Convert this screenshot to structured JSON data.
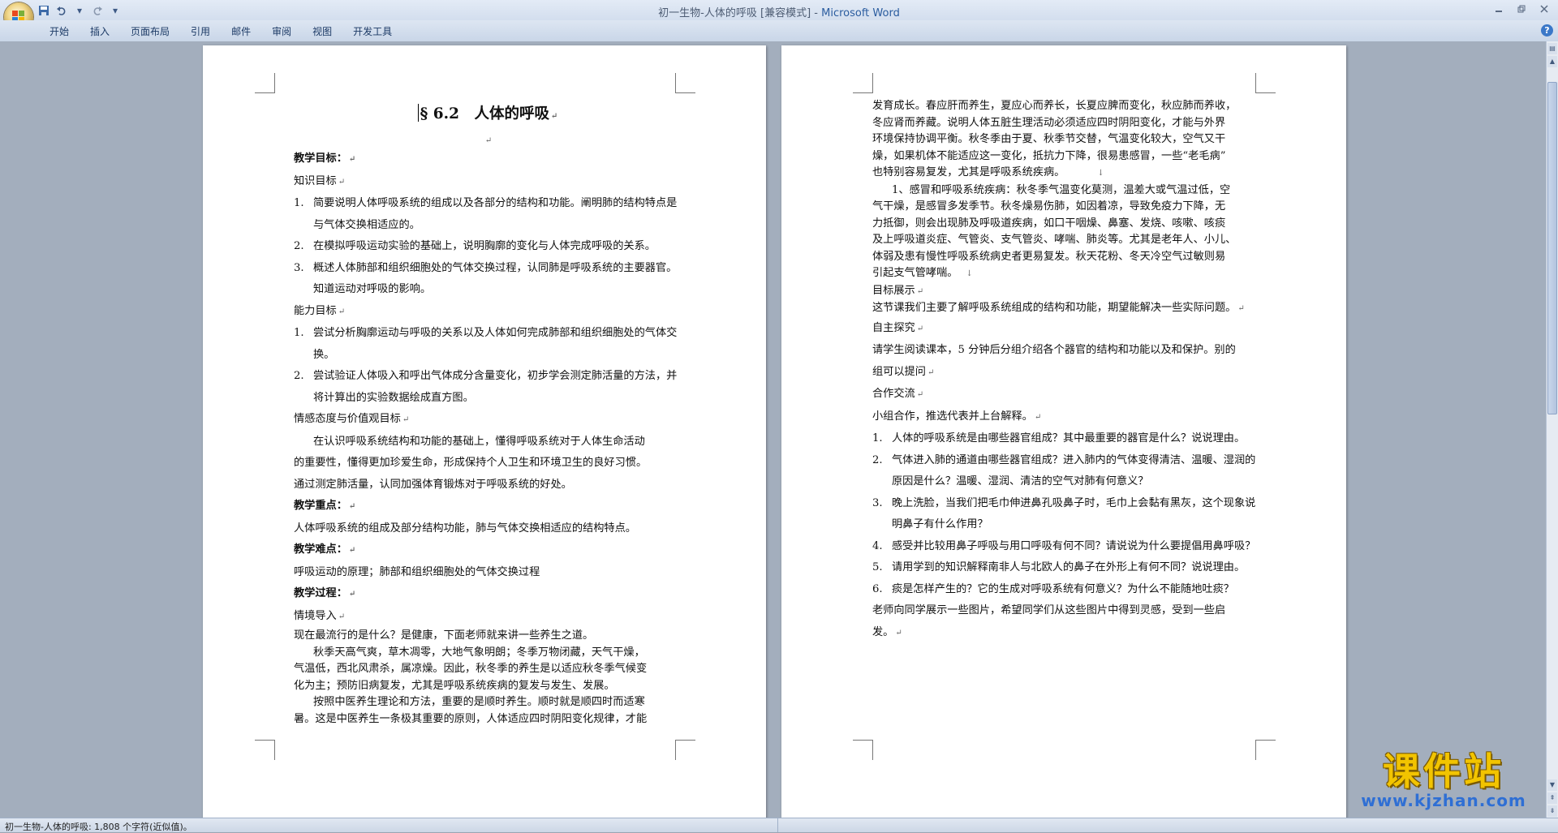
{
  "window": {
    "title_doc": "初一生物-人体的呼吸 [兼容模式] - ",
    "title_app": "Microsoft Word"
  },
  "ribbon": {
    "tabs": [
      "开始",
      "插入",
      "页面布局",
      "引用",
      "邮件",
      "审阅",
      "视图",
      "开发工具"
    ]
  },
  "quick_access": {
    "dropdown": "▾"
  },
  "colors": {
    "accent": "#2a5c9f",
    "watermark_yellow": "#f2c400",
    "watermark_blue": "#2f6fd4"
  },
  "page1": {
    "heading": "§ 6.2　人体的呼吸",
    "p_goals": "教学目标：",
    "p_knowledge": "知识目标",
    "k_items": [
      {
        "num": "1.",
        "text": "简要说明人体呼吸系统的组成以及各部分的结构和功能。阐明肺的结构特点是与气体交换相适应的。"
      },
      {
        "num": "2.",
        "text": "在模拟呼吸运动实验的基础上，说明胸廓的变化与人体完成呼吸的关系。"
      },
      {
        "num": "3.",
        "text": "概述人体肺部和组织细胞处的气体交换过程，认同肺是呼吸系统的主要器官。知道运动对呼吸的影响。"
      }
    ],
    "p_ability": "能力目标",
    "a_items": [
      {
        "num": "1.",
        "text": "尝试分析胸廓运动与呼吸的关系以及人体如何完成肺部和组织细胞处的气体交换。"
      },
      {
        "num": "2.",
        "text": "尝试验证人体吸入和呼出气体成分含量变化，初步学会测定肺活量的方法，并将计算出的实验数据绘成直方图。"
      }
    ],
    "p_emotion": "情感态度与价值观目标",
    "emotion_lines": [
      "在认识呼吸系统结构和功能的基础上，懂得呼吸系统对于人体生命活动",
      "的重要性，懂得更加珍爱生命，形成保持个人卫生和环境卫生的良好习惯。",
      "通过测定肺活量，认同加强体育锻炼对于呼吸系统的好处。"
    ],
    "p_key": "教学重点：",
    "key_text": "人体呼吸系统的组成及部分结构功能，肺与气体交换相适应的结构特点。",
    "p_diff": "教学难点：",
    "diff_text": "呼吸运动的原理；肺部和组织细胞处的气体交换过程",
    "p_process": "教学过程：",
    "p_intro": "情境导入",
    "intro_lines": [
      "现在最流行的是什么？是健康，下面老师就来讲一些养生之道。",
      "秋季天高气爽，草木凋零，大地气象明朗；冬季万物闭藏，天气干燥，",
      "气温低，西北风肃杀，属凉燥。因此，秋冬季的养生是以适应秋冬季气候变",
      "化为主；预防旧病复发，尤其是呼吸系统疾病的复发与发生、发展。",
      "按照中医养生理论和方法，重要的是顺时养生。顺时就是顺四时而适寒",
      "暑。这是中医养生一条极其重要的原则，人体适应四时阴阳变化规律，才能"
    ]
  },
  "page2": {
    "top_lines": [
      "发育成长。春应肝而养生，夏应心而养长，长夏应脾而变化，秋应肺而养收，",
      "冬应肾而养藏。说明人体五脏生理活动必须适应四时阴阳变化，才能与外界",
      "环境保持协调平衡。秋冬季由于夏、秋季节交替，气温变化较大，空气又干",
      "燥，如果机体不能适应这一变化，抵抗力下降，很易患感冒，一些“老毛病”",
      "也特别容易复发，尤其是呼吸系统疾病。"
    ],
    "cold_lines": [
      "1、感冒和呼吸系统疾病：秋冬季气温变化莫测，温差大或气温过低，空",
      "气干燥，是感冒多发季节。秋冬燥易伤肺，如因着凉，导致免疫力下降，无",
      "力抵御，则会出现肺及呼吸道疾病，如口干咽燥、鼻塞、发烧、咳嗽、咳痰",
      "及上呼吸道炎症、气管炎、支气管炎、哮喘、肺炎等。尤其是老年人、小儿、",
      "体弱及患有慢性呼吸系统病史者更易复发。秋天花粉、冬天冷空气过敏则易",
      "引起支气管哮喘。"
    ],
    "p_target_show": "目标展示",
    "target_text": "这节课我们主要了解呼吸系统组成的结构和功能，期望能解决一些实际问题。",
    "p_explore": "自主探究",
    "explore_lines": [
      "请学生阅读课本，5 分钟后分组介绍各个器官的结构和功能以及和保护。别的",
      "组可以提问"
    ],
    "p_coop": "合作交流",
    "coop_text": "小组合作，推选代表并上台解释。",
    "q_items": [
      {
        "num": "1.",
        "text": "人体的呼吸系统是由哪些器官组成？其中最重要的器官是什么？说说理由。"
      },
      {
        "num": "2.",
        "text": "气体进入肺的通道由哪些器官组成？进入肺内的气体变得清洁、温暖、湿润的原因是什么？温暖、湿润、清洁的空气对肺有何意义？"
      },
      {
        "num": "3.",
        "text": "晚上洗脸，当我们把毛巾伸进鼻孔吸鼻子时，毛巾上会黏有黑灰，这个现象说明鼻子有什么作用？"
      },
      {
        "num": "4.",
        "text": "感受并比较用鼻子呼吸与用口呼吸有何不同？请说说为什么要提倡用鼻呼吸？"
      },
      {
        "num": "5.",
        "text": "请用学到的知识解释南非人与北欧人的鼻子在外形上有何不同？说说理由。"
      },
      {
        "num": "6.",
        "text": "痰是怎样产生的？它的生成对呼吸系统有何意义？为什么不能随地吐痰？"
      }
    ],
    "end_lines": [
      "老师向同学展示一些图片，希望同学们从这些图片中得到灵感，受到一些启",
      "发。"
    ]
  },
  "status": {
    "text": "初一生物-人体的呼吸: 1,808 个字符(近似值)。"
  },
  "watermark": {
    "title": "课件站",
    "url": "www.kjzhan.com"
  },
  "marks": {
    "paragraph": "↵",
    "line_break": "↓"
  }
}
